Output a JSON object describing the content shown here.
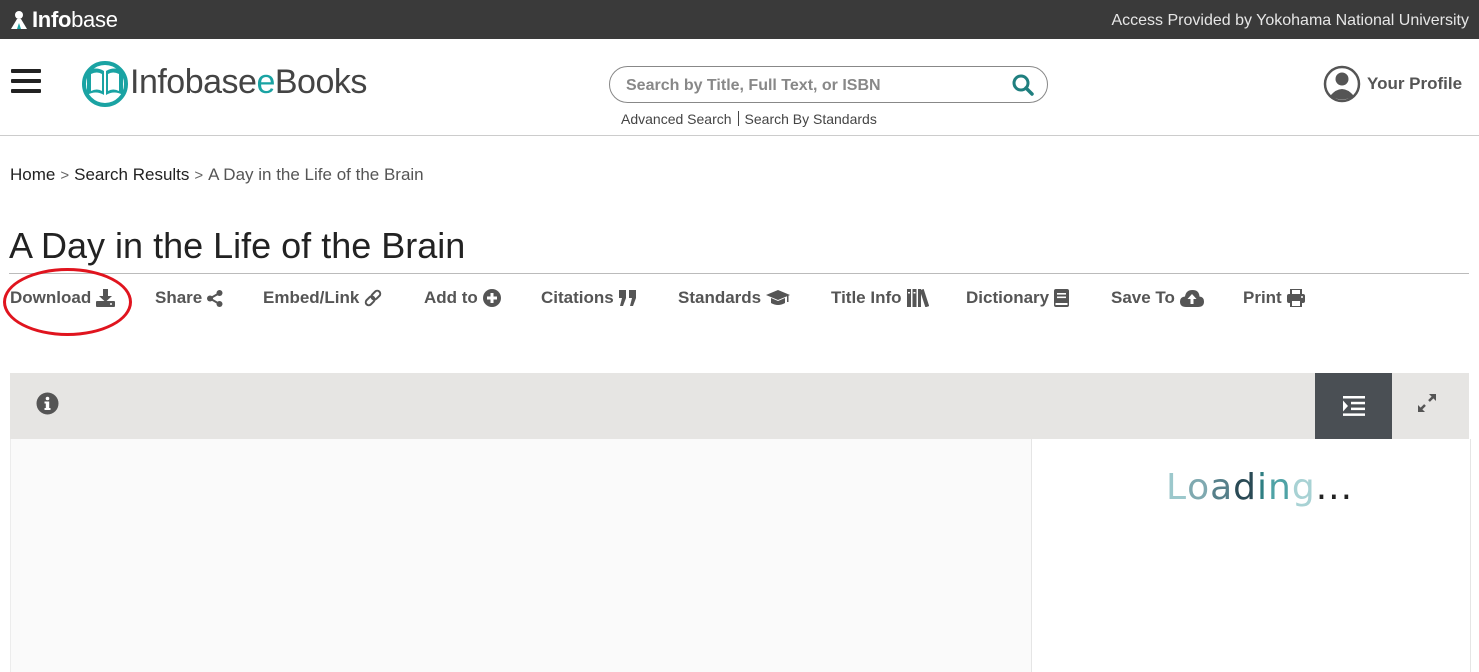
{
  "topbar": {
    "brand_prefix": "Info",
    "brand_suffix": "base",
    "access_text": "Access Provided by Yokohama National University"
  },
  "header": {
    "logo_prefix": "Infobase",
    "logo_e": "e",
    "logo_suffix": "Books",
    "search_placeholder": "Search by Title, Full Text, or ISBN",
    "search_value": "",
    "advanced_search": "Advanced Search",
    "search_by_standards": "Search By Standards",
    "profile_label": "Your Profile"
  },
  "breadcrumb": {
    "home": "Home",
    "search_results": "Search Results",
    "current": "A Day in the Life of the Brain",
    "separator": ">"
  },
  "page": {
    "title": "A Day in the Life of the Brain"
  },
  "toolbar": {
    "download": "Download",
    "share": "Share",
    "embed_link": "Embed/Link",
    "add_to": "Add to",
    "citations": "Citations",
    "standards": "Standards",
    "title_info": "Title Info",
    "dictionary": "Dictionary",
    "save_to": "Save To",
    "print": "Print"
  },
  "viewer": {
    "loading_letters": [
      "L",
      "o",
      "a",
      "d",
      "i",
      "n",
      "g",
      ".",
      ".",
      "."
    ]
  },
  "colors": {
    "accent": "#1aa3a3",
    "topbar_bg": "#3a3a3a",
    "annotation": "#e0141e",
    "toc_button_bg": "#4a4f54"
  }
}
